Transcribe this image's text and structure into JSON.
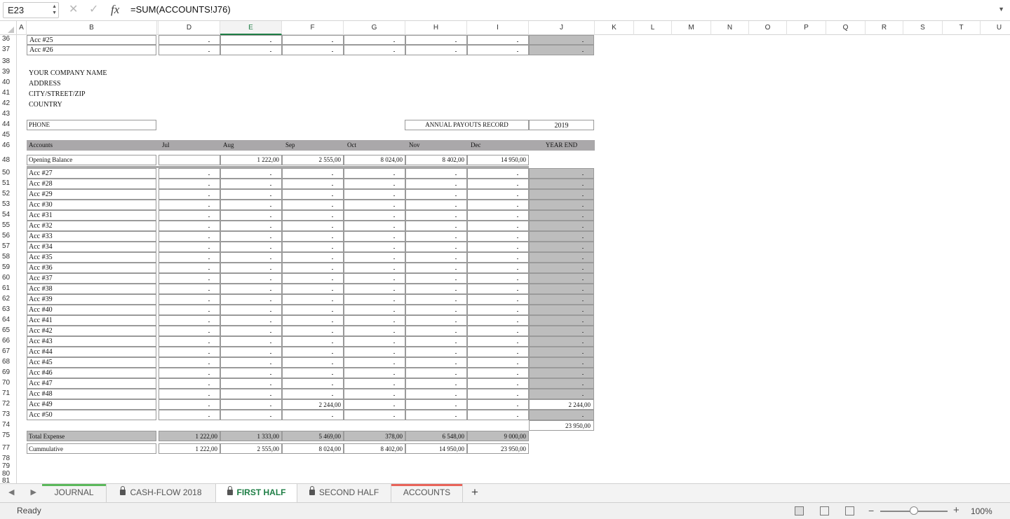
{
  "formula_bar": {
    "name_box": "E23",
    "fx_label": "fx",
    "formula": "=SUM(ACCOUNTS!J76)",
    "cancel_icon": "close-icon",
    "enter_icon": "check-icon"
  },
  "columns": [
    "A",
    "B",
    "",
    "D",
    "E",
    "F",
    "G",
    "H",
    "I",
    "J",
    "K",
    "L",
    "M",
    "N",
    "O",
    "P",
    "Q",
    "R",
    "S",
    "T",
    "U"
  ],
  "rows": [
    "36",
    "37",
    "38",
    "39",
    "40",
    "41",
    "42",
    "43",
    "44",
    "45",
    "46",
    "48",
    "50",
    "51",
    "52",
    "53",
    "54",
    "55",
    "56",
    "57",
    "58",
    "59",
    "60",
    "61",
    "62",
    "63",
    "64",
    "65",
    "66",
    "67",
    "68",
    "69",
    "70",
    "71",
    "72",
    "73",
    "74",
    "75",
    "77",
    "78",
    "79",
    "80",
    "81"
  ],
  "company": {
    "name": "YOUR COMPANY NAME",
    "address": "ADDRESS",
    "city": "CITY/STREET/ZIP",
    "country": "COUNTRY",
    "phone": "PHONE"
  },
  "record": {
    "label": "ANNUAL PAYOUTS RECORD",
    "year": "2019"
  },
  "table": {
    "headers": [
      "Accounts",
      "Jul",
      "Aug",
      "Sep",
      "Oct",
      "Nov",
      "Dec",
      "YEAR END"
    ],
    "opening": {
      "label": "Opening Balance",
      "values": [
        "",
        "1 222,00",
        "2 555,00",
        "8 024,00",
        "8 402,00",
        "14 950,00"
      ]
    },
    "top_accounts": [
      "Acc #25",
      "Acc #26"
    ],
    "accounts": [
      "Acc #27",
      "Acc #28",
      "Acc #29",
      "Acc #30",
      "Acc #31",
      "Acc #32",
      "Acc #33",
      "Acc #34",
      "Acc #35",
      "Acc #36",
      "Acc #37",
      "Acc #38",
      "Acc #39",
      "Acc #40",
      "Acc #41",
      "Acc #42",
      "Acc #43",
      "Acc #44",
      "Acc #45",
      "Acc #46",
      "Acc #47",
      "Acc #48",
      "Acc #49",
      "Acc #50"
    ],
    "acc49_sep": "2 244,00",
    "acc49_year": "2 244,00",
    "grand_total": "23 950,00",
    "total_expense": {
      "label": "Total Expense",
      "values": [
        "1 222,00",
        "1 333,00",
        "5 469,00",
        "378,00",
        "6 548,00",
        "9 000,00"
      ]
    },
    "cumulative": {
      "label": "Cummulative",
      "values": [
        "1 222,00",
        "2 555,00",
        "8 024,00",
        "8 402,00",
        "14 950,00",
        "23 950,00"
      ]
    }
  },
  "tabs": [
    {
      "label": "JOURNAL",
      "locked": false,
      "active": false,
      "color": "#5cb85c"
    },
    {
      "label": "CASH-FLOW 2018",
      "locked": true,
      "active": false,
      "color": ""
    },
    {
      "label": "FIRST HALF",
      "locked": true,
      "active": true,
      "color": ""
    },
    {
      "label": "SECOND HALF",
      "locked": true,
      "active": false,
      "color": ""
    },
    {
      "label": "ACCOUNTS",
      "locked": false,
      "active": false,
      "color": "#e8645a"
    }
  ],
  "status": {
    "ready": "Ready",
    "zoom": "100%"
  }
}
